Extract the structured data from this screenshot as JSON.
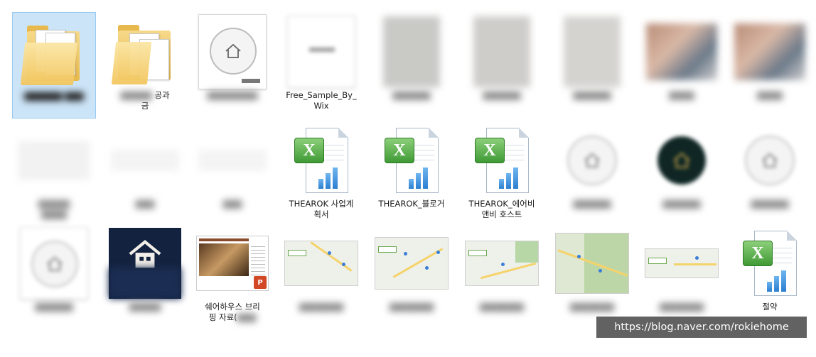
{
  "files": [
    {
      "label": "",
      "kind": "folder",
      "selected": true
    },
    {
      "label": "공과",
      "label2": "금",
      "kind": "folder"
    },
    {
      "label": "",
      "kind": "home-card"
    },
    {
      "label": "Free_Sample_By_",
      "label2": "Wix",
      "kind": "blank-card"
    },
    {
      "label": "",
      "kind": "photo"
    },
    {
      "label": "",
      "kind": "photo"
    },
    {
      "label": "",
      "kind": "photo"
    },
    {
      "label": "",
      "kind": "photo-color"
    },
    {
      "label": "",
      "kind": "photo-color"
    },
    {
      "label": "",
      "kind": "blurred-card"
    },
    {
      "label": "",
      "kind": "blurred-card"
    },
    {
      "label": "",
      "kind": "blurred-card"
    },
    {
      "label": "THEAROK 사업계",
      "label2": "획서",
      "kind": "excel"
    },
    {
      "label": "THEAROK_블로거",
      "kind": "excel"
    },
    {
      "label": "THEAROK_에어비",
      "label2": "앤비 호스트",
      "kind": "excel"
    },
    {
      "label": "",
      "kind": "home-circle"
    },
    {
      "label": "",
      "kind": "home-dark-circle"
    },
    {
      "label": "",
      "kind": "home-circle"
    },
    {
      "label": "",
      "kind": "home-card"
    },
    {
      "label": "",
      "kind": "navy-house"
    },
    {
      "label": "쉐어하우스 브리",
      "label2": "핑 자료(",
      "kind": "pptx"
    },
    {
      "label": "",
      "kind": "map"
    },
    {
      "label": "",
      "kind": "map"
    },
    {
      "label": "",
      "kind": "map"
    },
    {
      "label": "",
      "kind": "map-big"
    },
    {
      "label": "",
      "kind": "map"
    },
    {
      "label": "절약",
      "kind": "excel"
    }
  ],
  "watermark": "https://blog.naver.com/rokiehome",
  "colors": {
    "selection": "#cce4f7",
    "folder": "#f2c65e",
    "excel_green": "#3f9a34"
  }
}
